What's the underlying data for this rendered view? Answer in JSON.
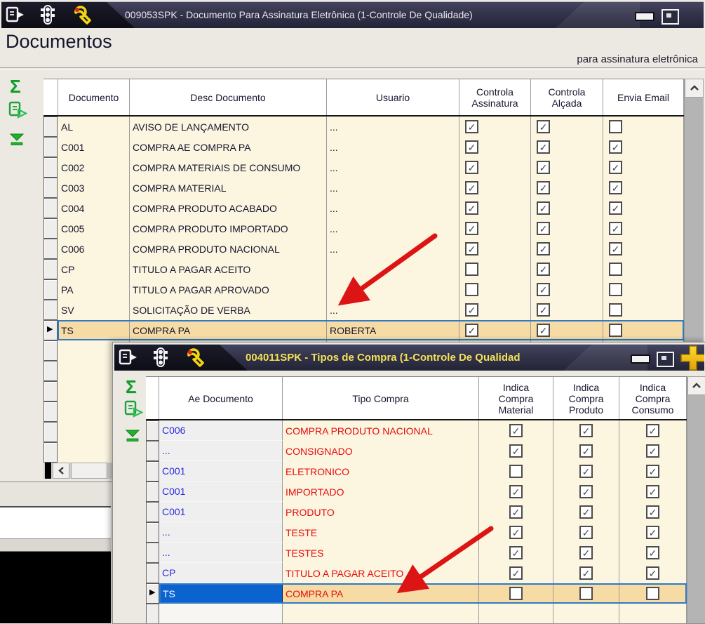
{
  "window1": {
    "title": "009053SPK - Documento Para Assinatura Eletrônica (1-Controle De Qualidade)",
    "heading": "Documentos",
    "tagline": "para assinatura eletrônica",
    "columns": {
      "documento": "Documento",
      "desc": "Desc Documento",
      "usuario": "Usuario",
      "assinatura": "Controla\nAssinatura",
      "alcada": "Controla\nAlçada",
      "email": "Envia Email"
    },
    "rows": [
      {
        "documento": "AL",
        "desc": "AVISO DE LANÇAMENTO",
        "usuario": "...",
        "assinatura": true,
        "alcada": true,
        "email": false,
        "selected": false
      },
      {
        "documento": "C001",
        "desc": "COMPRA AE COMPRA PA",
        "usuario": "...",
        "assinatura": true,
        "alcada": true,
        "email": true,
        "selected": false
      },
      {
        "documento": "C002",
        "desc": "COMPRA MATERIAIS DE CONSUMO",
        "usuario": "...",
        "assinatura": true,
        "alcada": true,
        "email": true,
        "selected": false
      },
      {
        "documento": "C003",
        "desc": "COMPRA MATERIAL",
        "usuario": "...",
        "assinatura": true,
        "alcada": true,
        "email": true,
        "selected": false
      },
      {
        "documento": "C004",
        "desc": "COMPRA PRODUTO ACABADO",
        "usuario": "...",
        "assinatura": true,
        "alcada": true,
        "email": true,
        "selected": false
      },
      {
        "documento": "C005",
        "desc": "COMPRA PRODUTO IMPORTADO",
        "usuario": "...",
        "assinatura": true,
        "alcada": true,
        "email": true,
        "selected": false
      },
      {
        "documento": "C006",
        "desc": "COMPRA PRODUTO NACIONAL",
        "usuario": "...",
        "assinatura": true,
        "alcada": true,
        "email": true,
        "selected": false
      },
      {
        "documento": "CP",
        "desc": "TITULO A PAGAR ACEITO",
        "usuario": "",
        "assinatura": false,
        "alcada": true,
        "email": false,
        "selected": false
      },
      {
        "documento": "PA",
        "desc": "TITULO A PAGAR APROVADO",
        "usuario": "",
        "assinatura": false,
        "alcada": true,
        "email": false,
        "selected": false
      },
      {
        "documento": "SV",
        "desc": "SOLICITAÇÃO DE VERBA",
        "usuario": "...",
        "assinatura": true,
        "alcada": true,
        "email": false,
        "selected": false
      },
      {
        "documento": "TS",
        "desc": "COMPRA PA",
        "usuario": "ROBERTA",
        "assinatura": true,
        "alcada": true,
        "email": false,
        "selected": true
      }
    ]
  },
  "window2": {
    "title": "004011SPK - Tipos de Compra (1-Controle De Qualidad",
    "columns": {
      "ae": "Ae Documento",
      "tipo": "Tipo Compra",
      "material": "Indica\nCompra\nMaterial",
      "produto": "Indica\nCompra\nProduto",
      "consumo": "Indica\nCompra\nConsumo"
    },
    "rows": [
      {
        "ae": "C006",
        "tipo": "COMPRA PRODUTO NACIONAL",
        "material": true,
        "produto": true,
        "consumo": true,
        "selected": false
      },
      {
        "ae": "...",
        "tipo": "CONSIGNADO",
        "material": true,
        "produto": true,
        "consumo": true,
        "selected": false
      },
      {
        "ae": "C001",
        "tipo": "ELETRONICO",
        "material": false,
        "produto": true,
        "consumo": true,
        "selected": false
      },
      {
        "ae": "C001",
        "tipo": "IMPORTADO",
        "material": true,
        "produto": true,
        "consumo": true,
        "selected": false
      },
      {
        "ae": "C001",
        "tipo": "PRODUTO",
        "material": true,
        "produto": true,
        "consumo": true,
        "selected": false
      },
      {
        "ae": "...",
        "tipo": "TESTE",
        "material": true,
        "produto": true,
        "consumo": true,
        "selected": false
      },
      {
        "ae": "...",
        "tipo": "TESTES",
        "material": true,
        "produto": true,
        "consumo": true,
        "selected": false
      },
      {
        "ae": "CP",
        "tipo": "TITULO A PAGAR ACEITO",
        "material": true,
        "produto": true,
        "consumo": true,
        "selected": false
      },
      {
        "ae": "TS",
        "tipo": "COMPRA PA",
        "material": false,
        "produto": false,
        "consumo": false,
        "selected": true
      }
    ]
  },
  "icons": {
    "sigma": "Σ",
    "check": "✓",
    "row_marker": "▶"
  },
  "colors": {
    "selection_fill": "#f6dca4",
    "selection_border": "#2e7ac6",
    "cell_bg": "#fcf5e0",
    "ae_blue_text": "#2a2ae0",
    "tipo_red_text": "#e80c0c",
    "annotation_arrow": "#dd1414",
    "title_yellow": "#f2e357"
  }
}
